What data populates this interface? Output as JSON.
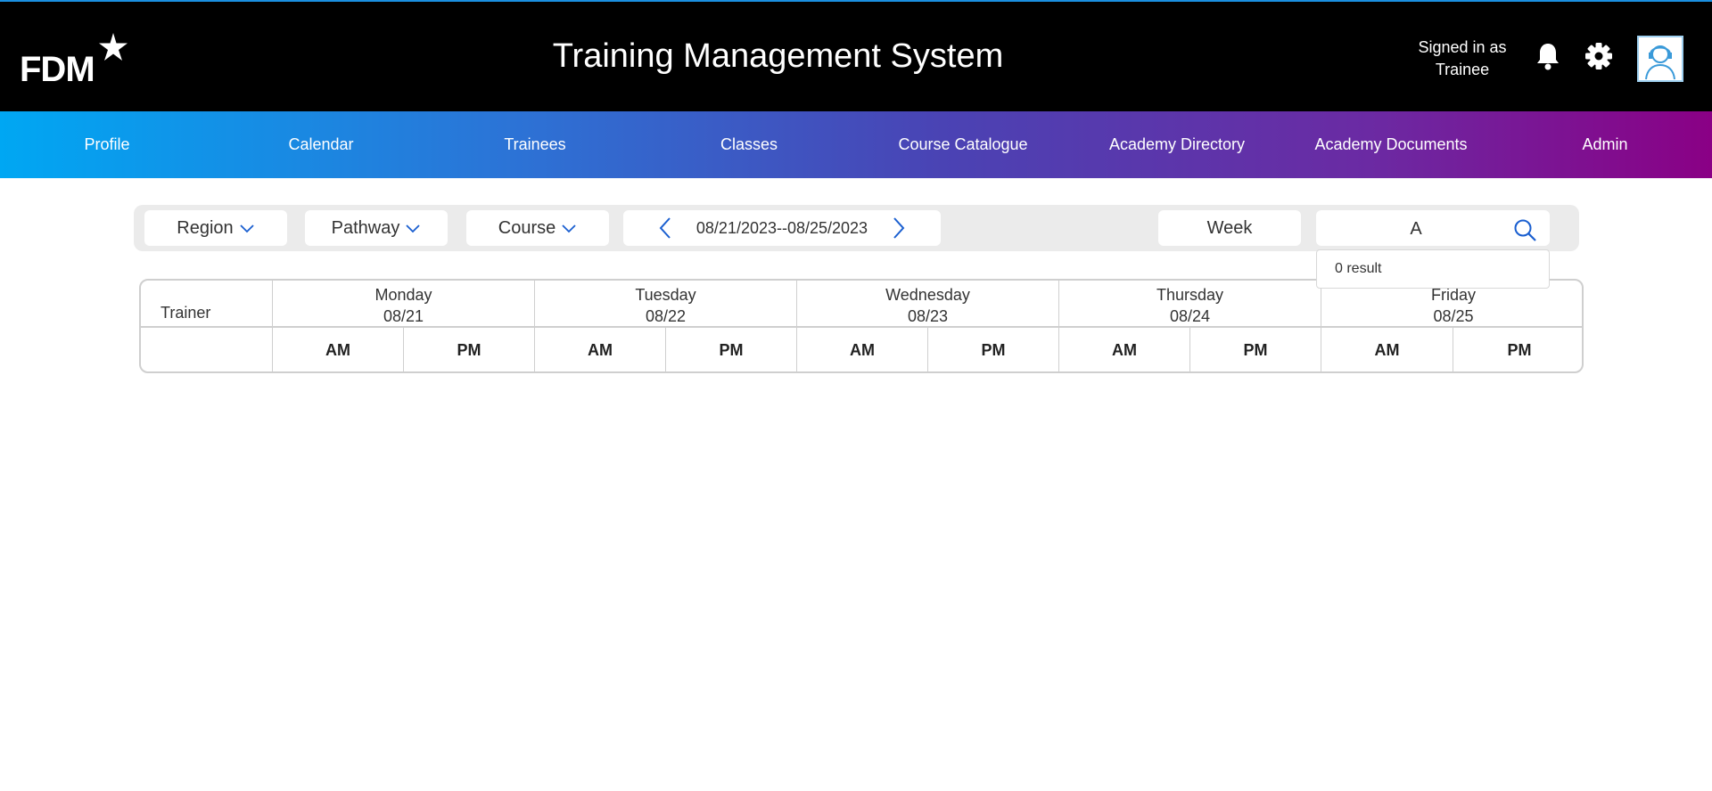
{
  "header": {
    "logo_text": "FDM",
    "title": "Training Management System",
    "signed_in_line1": "Signed in as",
    "signed_in_line2": "Trainee",
    "icons": [
      "bell-icon",
      "gear-icon",
      "avatar"
    ]
  },
  "nav": {
    "items": [
      {
        "label": "Profile"
      },
      {
        "label": "Calendar"
      },
      {
        "label": "Trainees"
      },
      {
        "label": "Classes"
      },
      {
        "label": "Course Catalogue"
      },
      {
        "label": "Academy Directory"
      },
      {
        "label": "Academy Documents"
      },
      {
        "label": "Admin"
      }
    ]
  },
  "filters": {
    "region": "Region",
    "pathway": "Pathway",
    "course": "Course",
    "date_range": "08/21/2023--08/25/2023",
    "view": "Week",
    "search_value": "A",
    "search_results": "0 result"
  },
  "schedule": {
    "trainer_header": "Trainer",
    "days": [
      {
        "name": "Monday",
        "date": "08/21"
      },
      {
        "name": "Tuesday",
        "date": "08/22"
      },
      {
        "name": "Wednesday",
        "date": "08/23"
      },
      {
        "name": "Thursday",
        "date": "08/24"
      },
      {
        "name": "Friday",
        "date": "08/25"
      }
    ],
    "am": "AM",
    "pm": "PM"
  },
  "colors": {
    "topbar": "#000000",
    "nav_start": "#00a7f3",
    "nav_end": "#8a0085",
    "accent": "#1a5fd0"
  }
}
